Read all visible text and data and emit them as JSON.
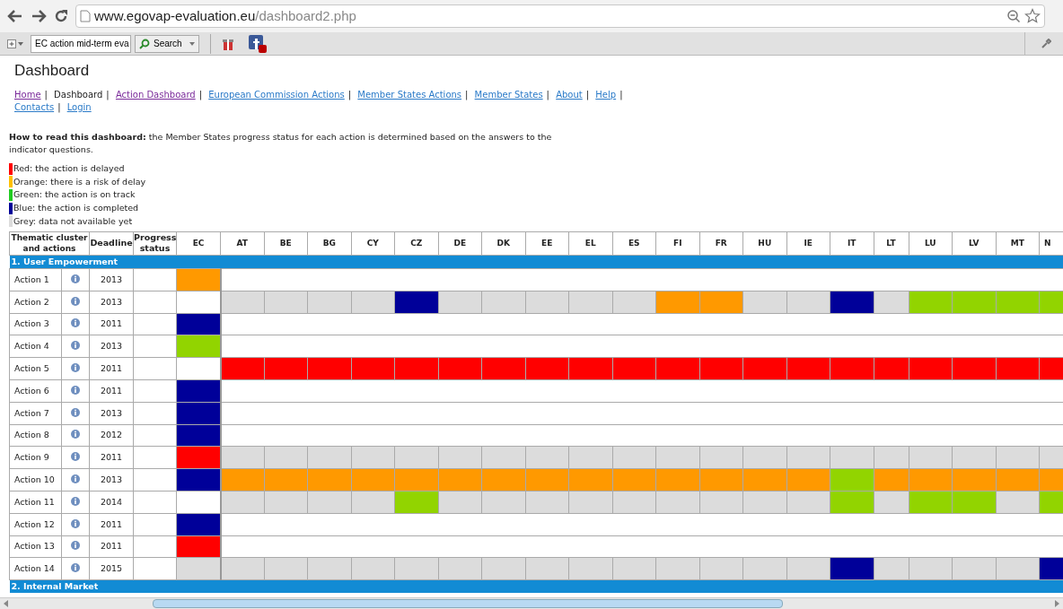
{
  "browser": {
    "url_host": "www.egovap-evaluation.eu",
    "url_path": "/dashboard2.php",
    "search_value": "EC action mid-term eva",
    "search_button": "Search"
  },
  "page_title": "Dashboard",
  "nav": [
    {
      "label": "Home",
      "link": true,
      "visited": true,
      "separator": "|"
    },
    {
      "label": "Dashboard",
      "link": false,
      "separator": "|"
    },
    {
      "label": "Action Dashboard",
      "link": true,
      "visited": true,
      "separator": "|"
    },
    {
      "label": "European Commission Actions",
      "link": true,
      "visited": false,
      "separator": "|"
    },
    {
      "label": "Member States Actions",
      "link": true,
      "visited": false,
      "separator": "|"
    },
    {
      "label": "Member States",
      "link": true,
      "visited": false,
      "separator": "|"
    },
    {
      "label": "About",
      "link": true,
      "visited": false,
      "separator": "|"
    },
    {
      "label": "Help",
      "link": true,
      "visited": false,
      "separator": "|"
    },
    {
      "label": "Contacts",
      "link": true,
      "visited": false,
      "separator": "|"
    },
    {
      "label": "Login",
      "link": true,
      "visited": false
    }
  ],
  "intro": "**How to read this dashboard:** the Member States progress status for each action is determined based on the answers to the indicator questions.",
  "legend": [
    {
      "label": "Red: the action is delayed",
      "color": "#ff0000"
    },
    {
      "label": "Orange: there is a risk of delay",
      "color": "#ffc000"
    },
    {
      "label": "Green: the action is on track",
      "color": "#22cc22"
    },
    {
      "label": "Blue: the action is completed",
      "color": "#000099"
    },
    {
      "label": "Grey: data not available yet",
      "color": "#dcdcdc"
    }
  ],
  "table": {
    "header": [
      "Thematic cluster and actions",
      "Deadline",
      "Progress status"
    ],
    "columns": [
      "EC",
      "AT",
      "BE",
      "BG",
      "CY",
      "CZ",
      "DE",
      "DK",
      "EE",
      "EL",
      "ES",
      "FI",
      "FR",
      "HU",
      "IE",
      "IT",
      "LT",
      "LU",
      "LV",
      "MT",
      "N"
    ],
    "sections": [
      {
        "title": "1. User Empowerment",
        "rows": [
          {
            "action": "Action 1",
            "deadline": "2013",
            "cells": [
              {
                "color": "#ff9900"
              }
            ]
          },
          {
            "action": "Action 2",
            "deadline": "2013",
            "cells": [
              {
                "color": "#ffffff"
              },
              {
                "color": "#dcdcdc"
              },
              {
                "color": "#dcdcdc"
              },
              {
                "color": "#dcdcdc"
              },
              {
                "color": "#dcdcdc"
              },
              {
                "color": "#000099"
              },
              {
                "color": "#dcdcdc"
              },
              {
                "color": "#dcdcdc"
              },
              {
                "color": "#dcdcdc"
              },
              {
                "color": "#dcdcdc"
              },
              {
                "color": "#dcdcdc"
              },
              {
                "color": "#ff9900"
              },
              {
                "color": "#ff9900"
              },
              {
                "color": "#dcdcdc"
              },
              {
                "color": "#dcdcdc"
              },
              {
                "color": "#000099"
              },
              {
                "color": "#dcdcdc"
              },
              {
                "color": "#92d400"
              },
              {
                "color": "#92d400"
              },
              {
                "color": "#92d400"
              },
              {
                "color": "#92d400"
              }
            ]
          },
          {
            "action": "Action 3",
            "deadline": "2011",
            "cells": [
              {
                "color": "#000099"
              }
            ]
          },
          {
            "action": "Action 4",
            "deadline": "2013",
            "cells": [
              {
                "color": "#92d400"
              }
            ]
          },
          {
            "action": "Action 5",
            "deadline": "2011",
            "cells": [
              {
                "color": "#ffffff"
              },
              {
                "color": "#ff0000"
              },
              {
                "color": "#ff0000"
              },
              {
                "color": "#ff0000"
              },
              {
                "color": "#ff0000"
              },
              {
                "color": "#ff0000"
              },
              {
                "color": "#ff0000"
              },
              {
                "color": "#ff0000"
              },
              {
                "color": "#ff0000"
              },
              {
                "color": "#ff0000"
              },
              {
                "color": "#ff0000"
              },
              {
                "color": "#ff0000"
              },
              {
                "color": "#ff0000"
              },
              {
                "color": "#ff0000"
              },
              {
                "color": "#ff0000"
              },
              {
                "color": "#ff0000"
              },
              {
                "color": "#ff0000"
              },
              {
                "color": "#ff0000"
              },
              {
                "color": "#ff0000"
              },
              {
                "color": "#ff0000"
              },
              {
                "color": "#ff0000"
              }
            ]
          },
          {
            "action": "Action 6",
            "deadline": "2011",
            "cells": [
              {
                "color": "#000099"
              }
            ]
          },
          {
            "action": "Action 7",
            "deadline": "2013",
            "cells": [
              {
                "color": "#000099"
              }
            ]
          },
          {
            "action": "Action 8",
            "deadline": "2012",
            "cells": [
              {
                "color": "#000099"
              }
            ]
          },
          {
            "action": "Action 9",
            "deadline": "2011",
            "cells": [
              {
                "color": "#ff0000"
              },
              {
                "color": "#dcdcdc"
              },
              {
                "color": "#dcdcdc"
              },
              {
                "color": "#dcdcdc"
              },
              {
                "color": "#dcdcdc"
              },
              {
                "color": "#dcdcdc"
              },
              {
                "color": "#dcdcdc"
              },
              {
                "color": "#dcdcdc"
              },
              {
                "color": "#dcdcdc"
              },
              {
                "color": "#dcdcdc"
              },
              {
                "color": "#dcdcdc"
              },
              {
                "color": "#dcdcdc"
              },
              {
                "color": "#dcdcdc"
              },
              {
                "color": "#dcdcdc"
              },
              {
                "color": "#dcdcdc"
              },
              {
                "color": "#dcdcdc"
              },
              {
                "color": "#dcdcdc"
              },
              {
                "color": "#dcdcdc"
              },
              {
                "color": "#dcdcdc"
              },
              {
                "color": "#dcdcdc"
              },
              {
                "color": "#dcdcdc"
              }
            ]
          },
          {
            "action": "Action 10",
            "deadline": "2013",
            "cells": [
              {
                "color": "#000099"
              },
              {
                "color": "#ff9900"
              },
              {
                "color": "#ff9900"
              },
              {
                "color": "#ff9900"
              },
              {
                "color": "#ff9900"
              },
              {
                "color": "#ff9900"
              },
              {
                "color": "#ff9900"
              },
              {
                "color": "#ff9900"
              },
              {
                "color": "#ff9900"
              },
              {
                "color": "#ff9900"
              },
              {
                "color": "#ff9900"
              },
              {
                "color": "#ff9900"
              },
              {
                "color": "#ff9900"
              },
              {
                "color": "#ff9900"
              },
              {
                "color": "#ff9900"
              },
              {
                "color": "#92d400"
              },
              {
                "color": "#ff9900"
              },
              {
                "color": "#ff9900"
              },
              {
                "color": "#ff9900"
              },
              {
                "color": "#ff9900"
              },
              {
                "color": "#ff9900"
              }
            ]
          },
          {
            "action": "Action 11",
            "deadline": "2014",
            "cells": [
              {
                "color": "#ffffff"
              },
              {
                "color": "#dcdcdc"
              },
              {
                "color": "#dcdcdc"
              },
              {
                "color": "#dcdcdc"
              },
              {
                "color": "#dcdcdc"
              },
              {
                "color": "#92d400"
              },
              {
                "color": "#dcdcdc"
              },
              {
                "color": "#dcdcdc"
              },
              {
                "color": "#dcdcdc"
              },
              {
                "color": "#dcdcdc"
              },
              {
                "color": "#dcdcdc"
              },
              {
                "color": "#dcdcdc"
              },
              {
                "color": "#dcdcdc"
              },
              {
                "color": "#dcdcdc"
              },
              {
                "color": "#dcdcdc"
              },
              {
                "color": "#92d400"
              },
              {
                "color": "#dcdcdc"
              },
              {
                "color": "#92d400"
              },
              {
                "color": "#92d400"
              },
              {
                "color": "#dcdcdc"
              },
              {
                "color": "#92d400"
              }
            ]
          },
          {
            "action": "Action 12",
            "deadline": "2011",
            "cells": [
              {
                "color": "#000099"
              }
            ]
          },
          {
            "action": "Action 13",
            "deadline": "2011",
            "cells": [
              {
                "color": "#ff0000"
              }
            ]
          },
          {
            "action": "Action 14",
            "deadline": "2015",
            "cells": [
              {
                "color": "#dcdcdc"
              },
              {
                "color": "#dcdcdc"
              },
              {
                "color": "#dcdcdc"
              },
              {
                "color": "#dcdcdc"
              },
              {
                "color": "#dcdcdc"
              },
              {
                "color": "#dcdcdc"
              },
              {
                "color": "#dcdcdc"
              },
              {
                "color": "#dcdcdc"
              },
              {
                "color": "#dcdcdc"
              },
              {
                "color": "#dcdcdc"
              },
              {
                "color": "#dcdcdc"
              },
              {
                "color": "#dcdcdc"
              },
              {
                "color": "#dcdcdc"
              },
              {
                "color": "#dcdcdc"
              },
              {
                "color": "#dcdcdc"
              },
              {
                "color": "#000099"
              },
              {
                "color": "#dcdcdc"
              },
              {
                "color": "#dcdcdc"
              },
              {
                "color": "#dcdcdc"
              },
              {
                "color": "#dcdcdc"
              },
              {
                "color": "#000099"
              }
            ]
          }
        ]
      },
      {
        "title": "2. Internal Market"
      }
    ]
  }
}
